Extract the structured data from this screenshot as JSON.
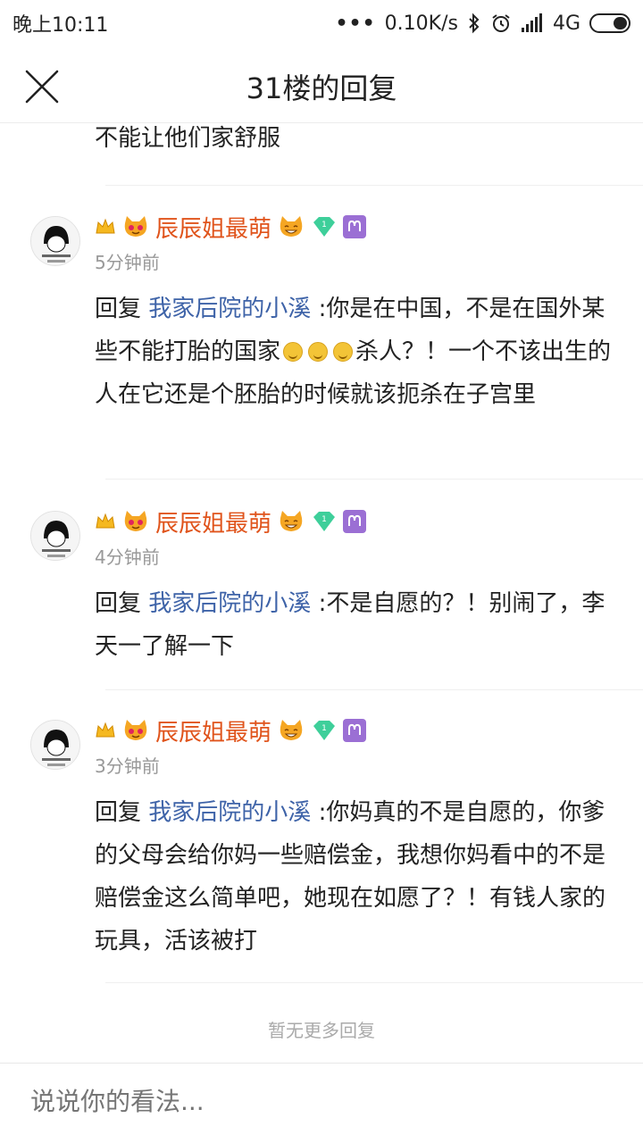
{
  "status_bar": {
    "time": "晚上10:11",
    "dots": "•••",
    "net_speed": "0.10K/s",
    "network": "4G"
  },
  "header": {
    "title": "31楼的回复"
  },
  "partial_text": "不能让他们家舒服",
  "replies": [
    {
      "username": "辰辰姐最萌",
      "time": "5分钟前",
      "prefix": "回复",
      "mention": "我家后院的小溪",
      "text_part1": " :你是在中国，不是在国外某些不能打胎的国家",
      "text_part2": "杀人？！一个不该出生的人在它还是个胚胎的时候就该扼杀在子宫里"
    },
    {
      "username": "辰辰姐最萌",
      "time": "4分钟前",
      "prefix": "回复",
      "mention": "我家后院的小溪",
      "text": " :不是自愿的？！别闹了，李天一了解一下"
    },
    {
      "username": "辰辰姐最萌",
      "time": "3分钟前",
      "prefix": "回复",
      "mention": "我家后院的小溪",
      "text": " :你妈真的不是自愿的，你爹的父母会给你妈一些赔偿金，我想你妈看中的不是赔偿金这么简单吧，她现在如愿了？！有钱人家的玩具，活该被打"
    }
  ],
  "badges": {
    "level": "1"
  },
  "footer_note": "暂无更多回复",
  "input": {
    "placeholder": "说说你的看法..."
  },
  "colors": {
    "username": "#e0541c",
    "mention": "#3e63a8",
    "time": "#999999"
  }
}
